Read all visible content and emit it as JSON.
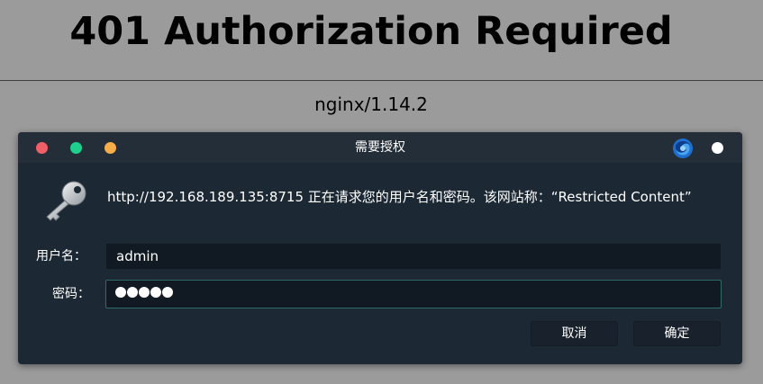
{
  "page": {
    "heading": "401 Authorization Required",
    "server_signature": "nginx/1.14.2"
  },
  "dialog": {
    "title": "需要授权",
    "message": "http://192.168.189.135:8715 正在请求您的用户名和密码。该网站称：“Restricted Content”",
    "username_label": "用户名：",
    "username_value": "admin",
    "password_label": "密码：",
    "password_mask_count": 5,
    "cancel_label": "取消",
    "ok_label": "确定"
  },
  "colors": {
    "page_background": "#9b9b9b",
    "dialog_background": "#1c2833",
    "traffic_close": "#f05f66",
    "traffic_maximize": "#1ecf8d",
    "traffic_minimize": "#f4ad4a"
  },
  "icons": [
    "close-button",
    "maximize-button",
    "minimize-button",
    "firefox-icon",
    "key-icon"
  ]
}
